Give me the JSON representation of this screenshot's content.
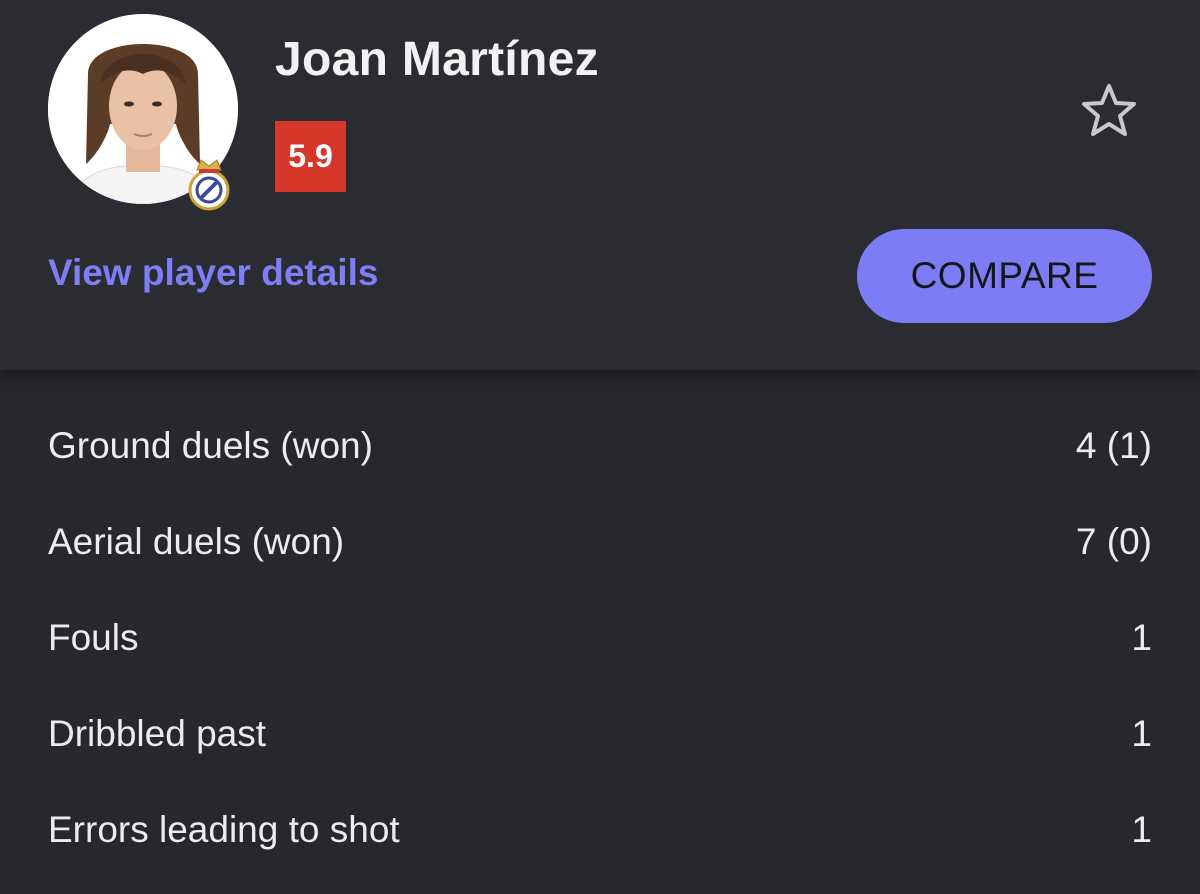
{
  "player": {
    "name": "Joan Martínez",
    "rating": "5.9",
    "rating_color": "#d5372b",
    "club_icon": "real-madrid-crest-icon",
    "favorite_icon": "star-outline-icon"
  },
  "actions": {
    "details_link": "View player details",
    "compare_label": "COMPARE",
    "accent_color": "#7c7cf5"
  },
  "stats": [
    {
      "label": "Ground duels (won)",
      "value": "4 (1)"
    },
    {
      "label": "Aerial duels (won)",
      "value": "7 (0)"
    },
    {
      "label": "Fouls",
      "value": "1"
    },
    {
      "label": "Dribbled past",
      "value": "1"
    },
    {
      "label": "Errors leading to shot",
      "value": "1"
    }
  ]
}
